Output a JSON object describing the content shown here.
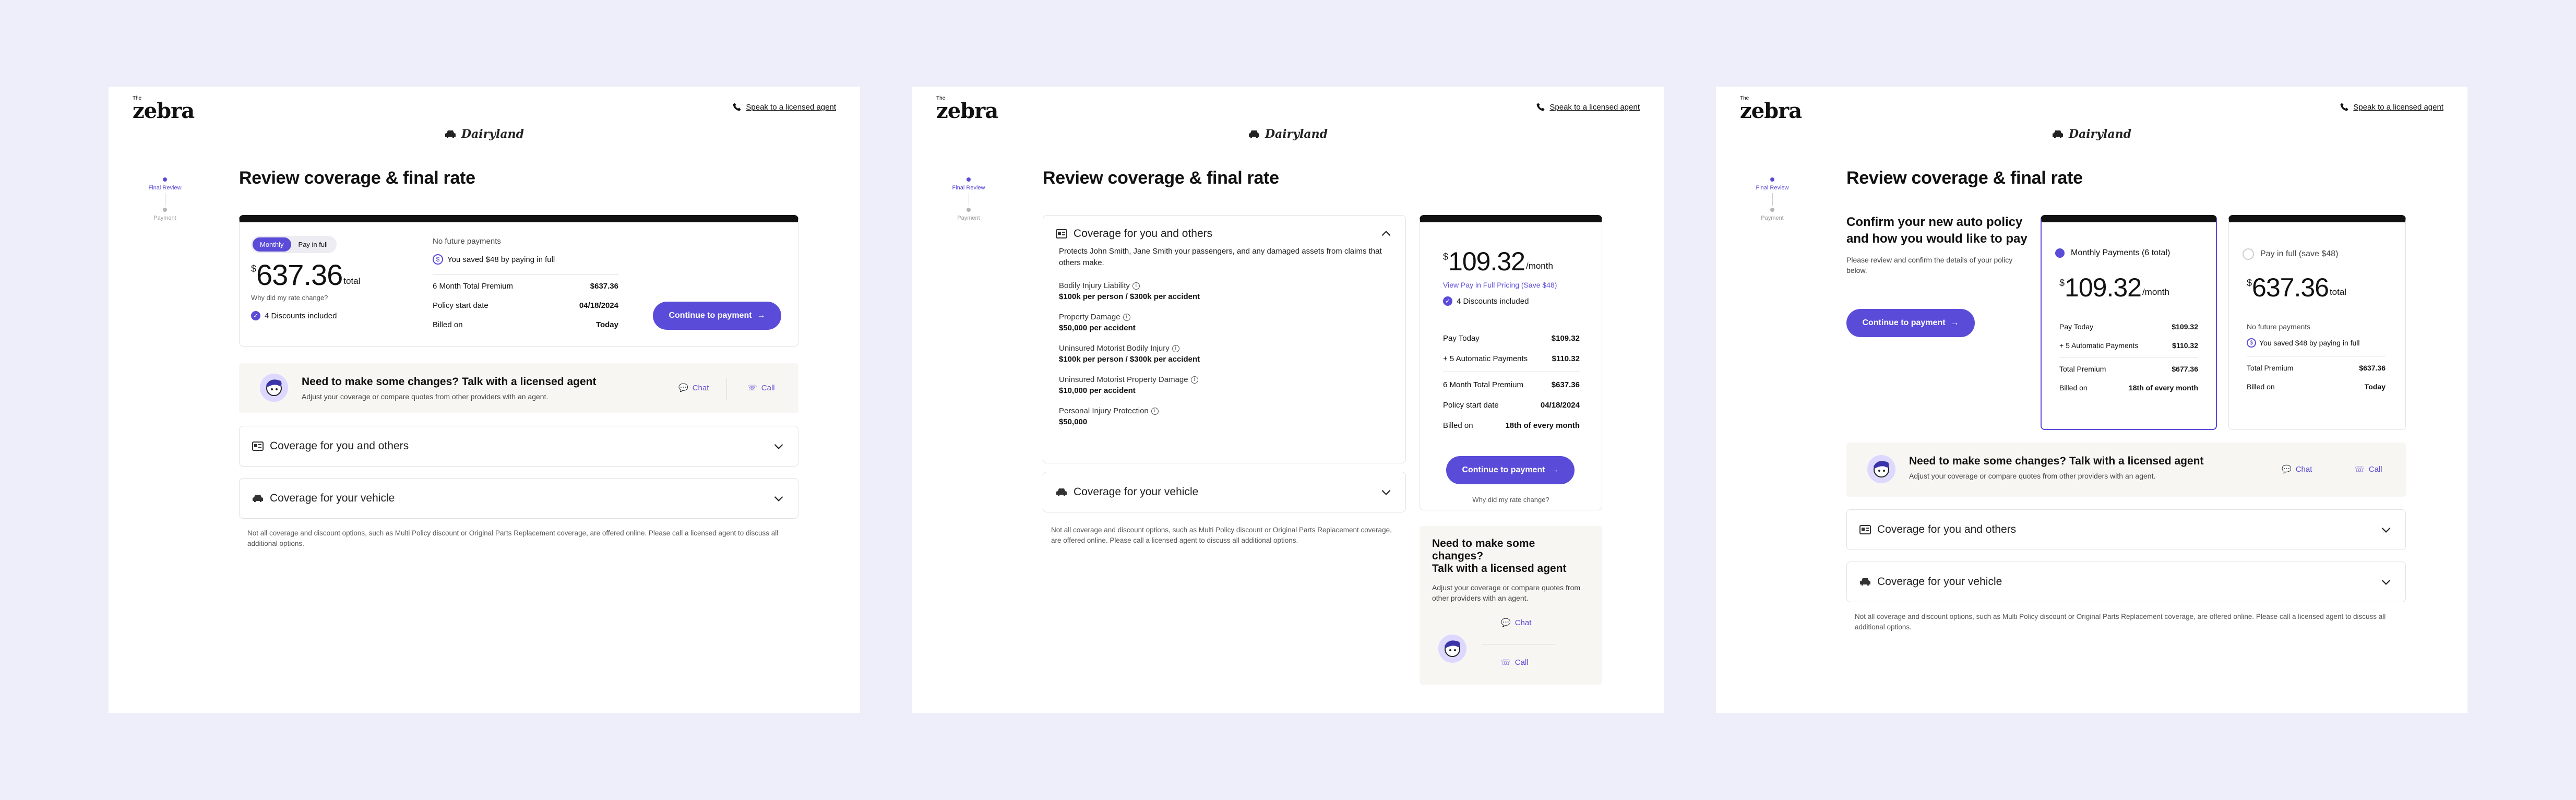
{
  "brand": {
    "the": "The",
    "name": "zebra"
  },
  "header": {
    "agent_link": "Speak to a licensed agent"
  },
  "carrier": {
    "name": "Dairyland"
  },
  "stepper": {
    "step1": "Final Review",
    "step2": "Payment"
  },
  "page_title": "Review coverage & final rate",
  "colors": {
    "accent": "#5a4bd9",
    "background": "#eeeefa",
    "help_bg": "#f8f6f2"
  },
  "panel1": {
    "toggle_monthly": "Monthly",
    "toggle_full": "Pay in full",
    "price_symbol": "$",
    "price": "637.36",
    "price_unit": "total",
    "why_rate": "Why did my rate change?",
    "discounts": "4 Discounts included",
    "future": "No future payments",
    "saved": "You saved $48 by paying in full",
    "rows": [
      {
        "label": "6 Month Total Premium",
        "value": "$637.36"
      },
      {
        "label": "Policy start date",
        "value": "04/18/2024"
      },
      {
        "label": "Billed on",
        "value": "Today"
      }
    ],
    "cta": "Continue to payment"
  },
  "help": {
    "title": "Need to make some changes? Talk with a licensed agent",
    "title_line1": "Need to make some changes?",
    "title_line2": "Talk with a licensed agent",
    "subtitle": "Adjust your coverage or compare quotes from other providers with an agent.",
    "chat": "Chat",
    "call": "Call"
  },
  "accordions": {
    "others": "Coverage for you and others",
    "vehicle": "Coverage for your vehicle"
  },
  "disclaimer": "Not all coverage and discount options, such as Multi Policy discount or Original Parts Replacement coverage, are offered online. Please call a licensed agent to discuss all additional options.",
  "panel2": {
    "coverage_desc": "Protects John Smith, Jane Smith your passengers, and any damaged assets from claims that others make.",
    "coverages": [
      {
        "label": "Bodily Injury Liability",
        "value": "$100k per person / $300k per accident"
      },
      {
        "label": "Property Damage",
        "value": "$50,000 per accident"
      },
      {
        "label": "Uninsured Motorist Bodily Injury",
        "value": "$100k per person / $300k per accident"
      },
      {
        "label": "Uninsured Motorist Property Damage",
        "value": "$10,000 per accident"
      },
      {
        "label": "Personal Injury Protection",
        "value": "$50,000"
      }
    ],
    "price_symbol": "$",
    "price": "109.32",
    "price_unit": "/month",
    "view_full": "View Pay in Full Pricing (Save $48)",
    "discounts": "4 Discounts included",
    "rows_a": [
      {
        "label": "Pay Today",
        "value": "$109.32"
      },
      {
        "label": "+ 5 Automatic Payments",
        "value": "$110.32"
      }
    ],
    "rows_b": [
      {
        "label": "6 Month Total Premium",
        "value": "$637.36"
      },
      {
        "label": "Policy start date",
        "value": "04/18/2024"
      },
      {
        "label": "Billed on",
        "value": "18th of every month"
      }
    ],
    "cta": "Continue to payment",
    "why_rate": "Why did my rate change?"
  },
  "panel3": {
    "confirm_title": "Confirm your new auto policy and how you would like to pay",
    "confirm_sub": "Please review and confirm the details of your policy below.",
    "cta": "Continue to payment",
    "monthly": {
      "label": "Monthly Payments (6 total)",
      "price_symbol": "$",
      "price": "109.32",
      "price_unit": "/month",
      "rows_a": [
        {
          "label": "Pay Today",
          "value": "$109.32"
        },
        {
          "label": "+ 5 Automatic Payments",
          "value": "$110.32"
        }
      ],
      "rows_b": [
        {
          "label": "Total Premium",
          "value": "$677.36"
        },
        {
          "label": "Billed on",
          "value": "18th of every month"
        }
      ]
    },
    "full": {
      "label": "Pay in full (save $48)",
      "price_symbol": "$",
      "price": "637.36",
      "price_unit": "total",
      "future": "No future payments",
      "saved": "You saved $48 by paying in full",
      "rows": [
        {
          "label": "Total Premium",
          "value": "$637.36"
        },
        {
          "label": "Billed on",
          "value": "Today"
        }
      ]
    }
  }
}
